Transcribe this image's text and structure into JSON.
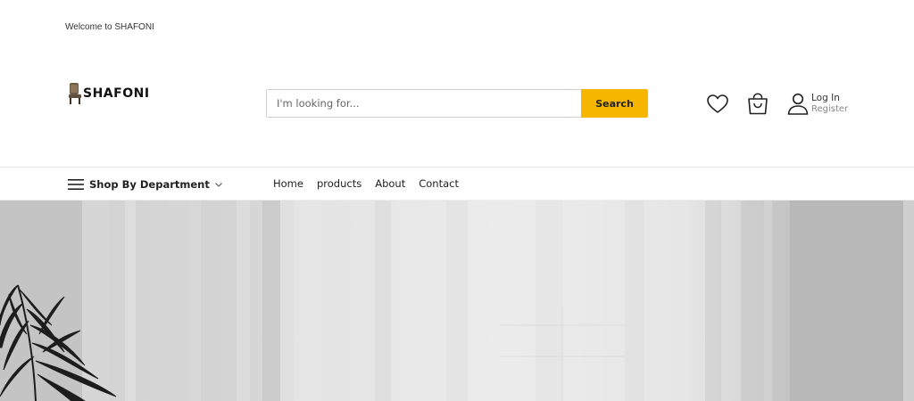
{
  "topbar": {
    "welcome_text": "Welcome to SHAFONI"
  },
  "header": {
    "logo_text": "SHAFONI",
    "search": {
      "placeholder": "I'm looking for...",
      "value": "",
      "button_label": "Search"
    },
    "account": {
      "login_label": "Log In",
      "register_label": "Register"
    },
    "icons": [
      "heart-icon",
      "shopping-bag-icon",
      "user-icon"
    ]
  },
  "nav": {
    "department_label": "Shop By Department",
    "links": [
      {
        "label": "Home"
      },
      {
        "label": "products"
      },
      {
        "label": "About"
      },
      {
        "label": "Contact"
      }
    ]
  },
  "colors": {
    "accent": "#f6b600",
    "text": "#222222",
    "muted": "#888888"
  }
}
